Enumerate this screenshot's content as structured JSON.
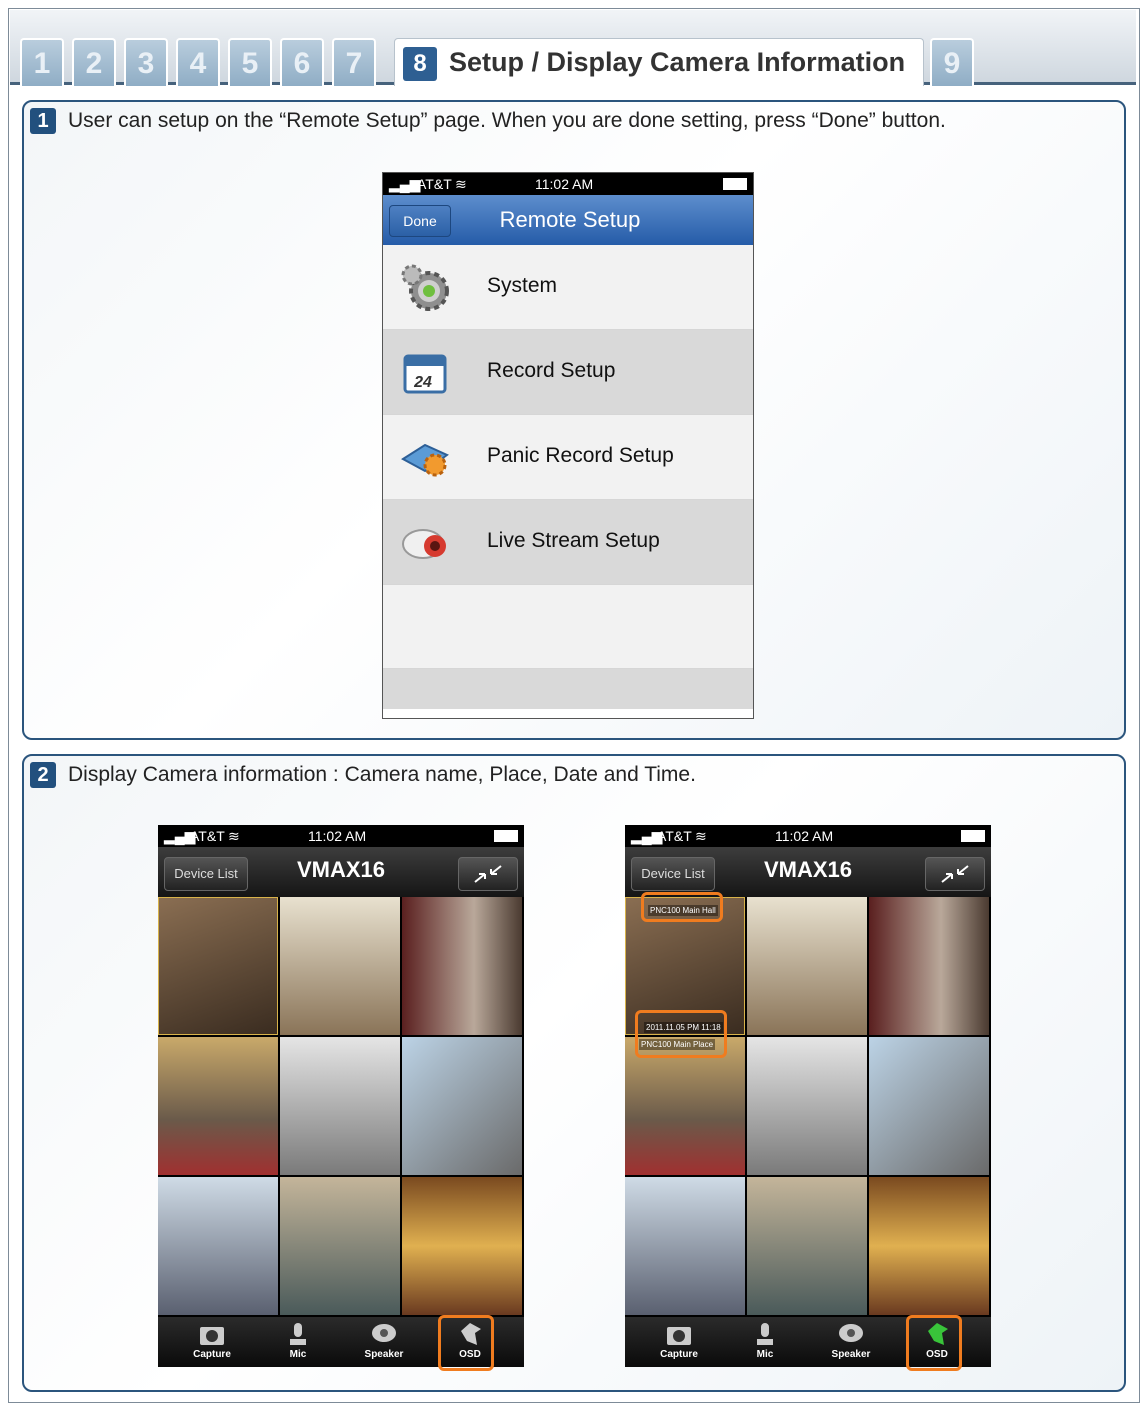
{
  "tabs": {
    "numbers": [
      "1",
      "2",
      "3",
      "4",
      "5",
      "6",
      "7"
    ],
    "active_number": "8",
    "active_title": "Setup / Display Camera Information",
    "after": "9"
  },
  "section1": {
    "badge": "1",
    "text": "User can setup on the “Remote Setup” page. When you are done setting, press “Done” button.",
    "phone": {
      "carrier": "AT&T",
      "time": "11:02 AM",
      "done_label": "Done",
      "title": "Remote Setup",
      "calendar_number": "24",
      "items": [
        {
          "label": "System",
          "icon": "gears-icon"
        },
        {
          "label": "Record Setup",
          "icon": "calendar-icon"
        },
        {
          "label": "Panic Record Setup",
          "icon": "panic-record-icon"
        },
        {
          "label": "Live Stream Setup",
          "icon": "camera-icon"
        }
      ]
    }
  },
  "section2": {
    "badge": "2",
    "text": "Display Camera information : Camera name, Place, Date and Time.",
    "phones": [
      {
        "carrier": "AT&T",
        "time": "11:02 AM",
        "device_list_label": "Device List",
        "title": "VMAX16",
        "toolbar": [
          "Capture",
          "Mic",
          "Speaker",
          "OSD"
        ]
      },
      {
        "carrier": "AT&T",
        "time": "11:02 AM",
        "device_list_label": "Device List",
        "title": "VMAX16",
        "toolbar": [
          "Capture",
          "Mic",
          "Speaker",
          "OSD"
        ],
        "osd_labels": {
          "camera_name": "PNC100 Main Hall",
          "date_time": "2011.11.05 PM 11:18",
          "place": "PNC100 Main Place"
        }
      }
    ]
  },
  "colors": {
    "accent": "#22507e",
    "highlight": "#f07c1f",
    "nav_blue": "#255ca8"
  }
}
